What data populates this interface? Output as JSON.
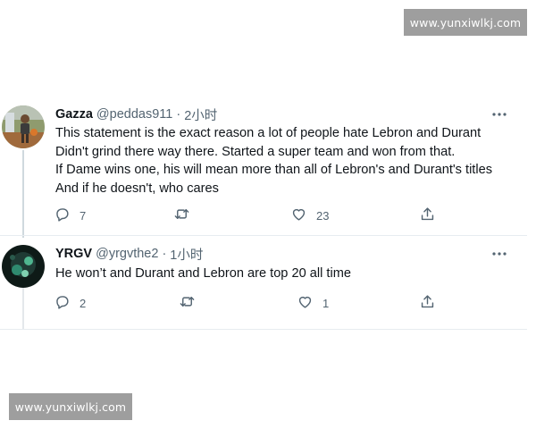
{
  "watermark": "www.yunxiwlkj.com",
  "tweets": [
    {
      "name": "Gazza",
      "handle": "@peddas911",
      "separator": "·",
      "time": "2小时",
      "more_icon": "more-horizontal-icon",
      "text_lines": [
        "This statement is the exact reason a lot of people hate Lebron and Durant",
        "Didn't grind there way there. Started a super team and won from that.",
        "If Dame wins one, his will mean more than all of Lebron's and Durant's titles",
        "And if he doesn't, who cares"
      ],
      "replies": "7",
      "retweets": "",
      "likes": "23"
    },
    {
      "name": "YRGV",
      "handle": "@yrgvthe2",
      "separator": "·",
      "time": "1小时",
      "more_icon": "more-horizontal-icon",
      "text_lines": [
        "He won’t and Durant and Lebron are top 20 all time"
      ],
      "replies": "2",
      "retweets": "",
      "likes": "1"
    }
  ],
  "icons": {
    "reply": "reply-icon",
    "retweet": "retweet-icon",
    "like": "like-icon",
    "share": "share-icon"
  },
  "colors": {
    "text": "#0f1419",
    "secondary": "#536471",
    "thread_line": "#cfd9de"
  }
}
